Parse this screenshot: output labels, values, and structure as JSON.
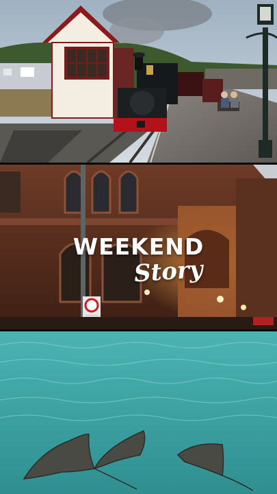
{
  "overlay": {
    "title": "WEEKEND",
    "subtitle": "Story"
  },
  "panels": [
    {
      "name": "steam-train-station-photo"
    },
    {
      "name": "brick-building-night-photo"
    },
    {
      "name": "stingrays-water-photo"
    }
  ],
  "colors": {
    "sky": "#aebfcc",
    "brick": "#6b3522",
    "water": "#3fa7a8",
    "text": "#ffffff"
  }
}
